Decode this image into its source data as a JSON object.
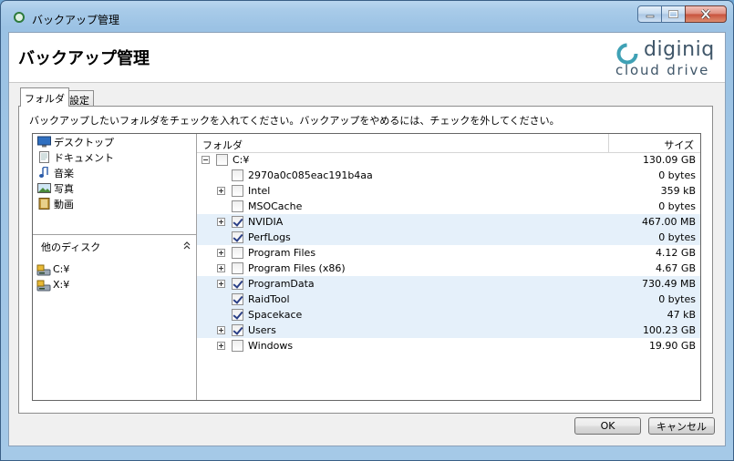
{
  "window": {
    "title": "バックアップ管理"
  },
  "header": {
    "title": "バックアップ管理"
  },
  "logo": {
    "word": "diginiq",
    "subtitle": "cloud drive"
  },
  "tabs": [
    {
      "label": "フォルダ",
      "active": true
    },
    {
      "label": "設定",
      "active": false
    }
  ],
  "instruction": "バックアップしたいフォルダをチェックを入れてください。バックアップをやめるには、チェックを外してください。",
  "libraries": [
    {
      "label": "デスクトップ",
      "icon": "desktop-icon"
    },
    {
      "label": "ドキュメント",
      "icon": "document-icon"
    },
    {
      "label": "音楽",
      "icon": "music-icon"
    },
    {
      "label": "写真",
      "icon": "picture-icon"
    },
    {
      "label": "動画",
      "icon": "video-icon"
    }
  ],
  "other_disks": {
    "label": "他のディスク",
    "drives": [
      "C:¥",
      "X:¥"
    ]
  },
  "columns": {
    "folder": "フォルダ",
    "size": "サイズ"
  },
  "rows": [
    {
      "name": "C:¥",
      "size": "130.09 GB",
      "level": 0,
      "expander": "minus",
      "checked": false,
      "selected": false
    },
    {
      "name": "2970a0c085eac191b4aa",
      "size": "0 bytes",
      "level": 1,
      "expander": "none",
      "checked": false,
      "selected": false
    },
    {
      "name": "Intel",
      "size": "359 kB",
      "level": 1,
      "expander": "plus",
      "checked": false,
      "selected": false
    },
    {
      "name": "MSOCache",
      "size": "0 bytes",
      "level": 1,
      "expander": "none",
      "checked": false,
      "selected": false
    },
    {
      "name": "NVIDIA",
      "size": "467.00 MB",
      "level": 1,
      "expander": "plus",
      "checked": true,
      "selected": true
    },
    {
      "name": "PerfLogs",
      "size": "0 bytes",
      "level": 1,
      "expander": "none",
      "checked": true,
      "selected": true
    },
    {
      "name": "Program Files",
      "size": "4.12 GB",
      "level": 1,
      "expander": "plus",
      "checked": false,
      "selected": false
    },
    {
      "name": "Program Files (x86)",
      "size": "4.67 GB",
      "level": 1,
      "expander": "plus",
      "checked": false,
      "selected": false
    },
    {
      "name": "ProgramData",
      "size": "730.49 MB",
      "level": 1,
      "expander": "plus",
      "checked": true,
      "selected": true
    },
    {
      "name": "RaidTool",
      "size": "0 bytes",
      "level": 1,
      "expander": "none",
      "checked": true,
      "selected": true
    },
    {
      "name": "Spacekace",
      "size": "47 kB",
      "level": 1,
      "expander": "none",
      "checked": true,
      "selected": true
    },
    {
      "name": "Users",
      "size": "100.23 GB",
      "level": 1,
      "expander": "plus",
      "checked": true,
      "selected": true
    },
    {
      "name": "Windows",
      "size": "19.90 GB",
      "level": 1,
      "expander": "plus",
      "checked": false,
      "selected": false
    }
  ],
  "buttons": {
    "ok": "OK",
    "cancel": "キャンセル"
  }
}
